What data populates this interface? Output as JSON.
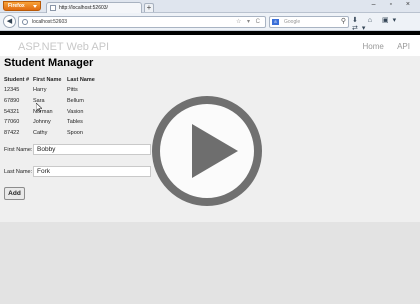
{
  "browser": {
    "app_button": "Firefox",
    "tab_title": "http://localhost:52603/",
    "new_tab": "+",
    "window_controls": "–  ▫  ×",
    "url": "localhost:52603",
    "url_icons": "☆ ▾ C",
    "search_placeholder": "Google",
    "search_engine_icon": "g-icon",
    "search_icon": "magnifier-icon",
    "toolbar_icons": "⬇ ⌂ ▣▾ ⇄▾"
  },
  "site": {
    "title": "ASP.NET Web API",
    "nav": [
      "Home",
      "API"
    ]
  },
  "page": {
    "heading": "Student Manager",
    "table": {
      "headers": [
        "Student #",
        "First Name",
        "Last Name"
      ],
      "rows": [
        [
          "12345",
          "Harry",
          "Pitts"
        ],
        [
          "67890",
          "Sara",
          "Bellum"
        ],
        [
          "54321",
          "Norman",
          "Vasion"
        ],
        [
          "77060",
          "Johnny",
          "Tables"
        ],
        [
          "87422",
          "Cathy",
          "Spoon"
        ]
      ]
    },
    "form": {
      "first_name_label": "First Name:",
      "first_name_value": "Bobby",
      "last_name_label": "Last Name:",
      "last_name_value": "Fork"
    },
    "add_button": "Add"
  },
  "overlay": {
    "icon": "play-icon"
  }
}
